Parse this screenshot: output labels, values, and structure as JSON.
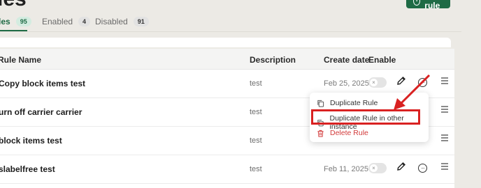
{
  "page": {
    "title": "les"
  },
  "header": {
    "add_button_label": "Add rule"
  },
  "tabs": [
    {
      "label": "les",
      "count": "95"
    },
    {
      "label": "Enabled",
      "count": "4"
    },
    {
      "label": "Disabled",
      "count": "91"
    }
  ],
  "table": {
    "columns": [
      "Rule Name",
      "Description",
      "Create date",
      "Enable"
    ],
    "rows": [
      {
        "name": "Copy block items test",
        "description": "test",
        "date": "Feb 25, 2025"
      },
      {
        "name": "urn off carrier carrier",
        "description": "test",
        "date": ""
      },
      {
        "name": "block items test",
        "description": "test",
        "date": ""
      },
      {
        "name": "slabelfree test",
        "description": "test",
        "date": "Feb 11, 2025"
      }
    ]
  },
  "context_menu": {
    "items": [
      {
        "label": "Duplicate Rule",
        "icon": "copy-icon"
      },
      {
        "label": "Duplicate Rule in other instance",
        "icon": "copy-icon"
      },
      {
        "label": "Delete Rule",
        "icon": "trash-icon"
      }
    ]
  },
  "colors": {
    "accent": "#1f6b45",
    "danger": "#d92121",
    "background": "#eceae5"
  }
}
